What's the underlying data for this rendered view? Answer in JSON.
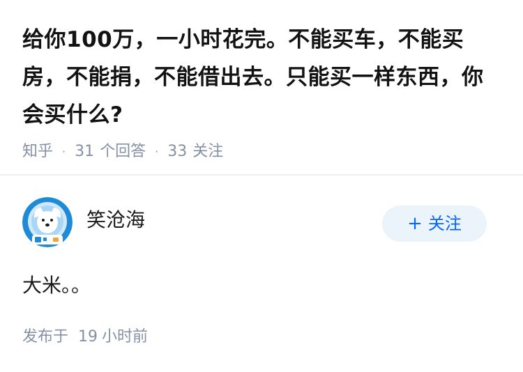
{
  "question": {
    "title": "给你100万，一小时花完。不能买车，不能买房，不能捐，不能借出去。只能买一样东西，你会买什么?",
    "source": "知乎",
    "separator": "·",
    "answers_count": "31",
    "answers_label": "个回答",
    "followers_count": "33",
    "followers_label": "关注"
  },
  "answer": {
    "author": {
      "name": "笑沧海",
      "avatar_icon": "dog-astronaut-avatar"
    },
    "follow_button": {
      "icon": "plus-icon",
      "plus": "+",
      "label": "关注",
      "accent": "#0066ff",
      "background": "#ebf3fb"
    },
    "content": "大米。。",
    "published_prefix": "发布于",
    "published_value": "19",
    "published_suffix": "小时前"
  },
  "colors": {
    "title": "#121212",
    "meta": "#8590a6",
    "divider": "#f0f0f2"
  }
}
